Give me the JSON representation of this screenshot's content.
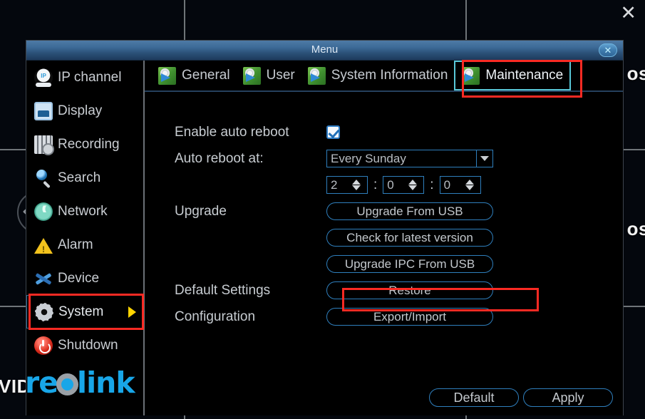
{
  "background": {
    "close_x": "✕",
    "labels": [
      "os",
      "os",
      "VID"
    ]
  },
  "window": {
    "title": "Menu",
    "close_label": "✕"
  },
  "sidebar": {
    "items": [
      {
        "label": "IP channel",
        "icon": "ip-camera-icon",
        "selected": false
      },
      {
        "label": "Display",
        "icon": "display-icon",
        "selected": false
      },
      {
        "label": "Recording",
        "icon": "recording-icon",
        "selected": false
      },
      {
        "label": "Search",
        "icon": "search-icon",
        "selected": false
      },
      {
        "label": "Network",
        "icon": "network-icon",
        "selected": false
      },
      {
        "label": "Alarm",
        "icon": "alarm-warning-icon",
        "selected": false
      },
      {
        "label": "Device",
        "icon": "device-tools-icon",
        "selected": false
      },
      {
        "label": "System",
        "icon": "system-gear-icon",
        "selected": true
      },
      {
        "label": "Shutdown",
        "icon": "power-icon",
        "selected": false
      }
    ],
    "logo": {
      "pre": "re",
      "post": "link"
    }
  },
  "tabs": [
    {
      "label": "General",
      "active": false
    },
    {
      "label": "User",
      "active": false
    },
    {
      "label": "System Information",
      "active": false
    },
    {
      "label": "Maintenance",
      "active": true
    }
  ],
  "form": {
    "enable_auto_reboot_label": "Enable auto reboot",
    "enable_auto_reboot_checked": true,
    "auto_reboot_at_label": "Auto reboot at:",
    "schedule_value": "Every Sunday",
    "time": {
      "hour": "2",
      "minute": "0",
      "second": "0",
      "separator": ":"
    },
    "upgrade_label": "Upgrade",
    "upgrade_from_usb": "Upgrade From USB",
    "check_latest_version": "Check for latest version",
    "upgrade_ipc_from_usb": "Upgrade IPC From USB",
    "default_settings_label": "Default Settings",
    "restore_button": "Restore",
    "configuration_label": "Configuration",
    "export_import_button": "Export/Import"
  },
  "footer": {
    "default_button": "Default",
    "apply_button": "Apply"
  },
  "colors": {
    "accent": "#2f7fbd",
    "annotation": "#fb2a23",
    "tab_active_border": "#59c8d8",
    "logo": "#18a6e8",
    "arrow": "#ffd400"
  }
}
